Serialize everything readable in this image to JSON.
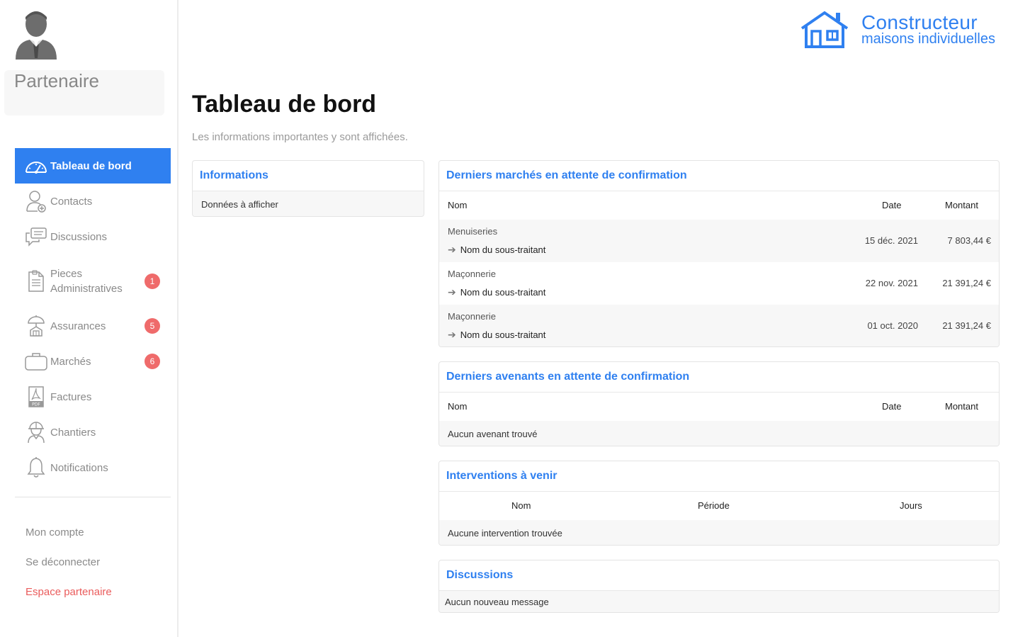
{
  "sidebar": {
    "partner_name": "Partenaire",
    "nav": [
      {
        "label": "Tableau de bord",
        "icon": "dashboard-icon",
        "active": true
      },
      {
        "label": "Contacts",
        "icon": "contacts-icon"
      },
      {
        "label": "Discussions",
        "icon": "discussions-icon"
      },
      {
        "label": "Pieces\nAdministratives",
        "icon": "documents-icon",
        "badge": "1"
      },
      {
        "label": "Assurances",
        "icon": "insurance-icon",
        "badge": "5"
      },
      {
        "label": "Marchés",
        "icon": "briefcase-icon",
        "badge": "6"
      },
      {
        "label": "Factures",
        "icon": "pdf-icon"
      },
      {
        "label": "Chantiers",
        "icon": "worker-icon"
      },
      {
        "label": "Notifications",
        "icon": "bell-icon"
      }
    ],
    "account": {
      "my_account": "Mon compte",
      "logout": "Se déconnecter",
      "partner_space": "Espace partenaire"
    }
  },
  "logo": {
    "title": "Constructeur",
    "subtitle": "maisons individuelles"
  },
  "header": {
    "title": "Tableau de bord",
    "subtitle": "Les informations importantes y sont affichées."
  },
  "informations": {
    "title": "Informations",
    "row": "Données à afficher"
  },
  "marches": {
    "title": "Derniers marchés en attente de confirmation",
    "columns": {
      "name": "Nom",
      "date": "Date",
      "amount": "Montant"
    },
    "rows": [
      {
        "name": "Menuiseries",
        "sub": "Nom du sous-traitant",
        "date": "15 déc. 2021",
        "amount": "7 803,44 €"
      },
      {
        "name": "Maçonnerie",
        "sub": "Nom du sous-traitant",
        "date": "22 nov. 2021",
        "amount": "21 391,24 €"
      },
      {
        "name": "Maçonnerie",
        "sub": "Nom du sous-traitant",
        "date": "01 oct. 2020",
        "amount": "21 391,24 €"
      }
    ]
  },
  "avenants": {
    "title": "Derniers avenants en attente de confirmation",
    "columns": {
      "name": "Nom",
      "date": "Date",
      "amount": "Montant"
    },
    "empty": "Aucun avenant trouvé"
  },
  "interventions": {
    "title": "Interventions à venir",
    "columns": {
      "name": "Nom",
      "period": "Période",
      "days": "Jours"
    },
    "empty": "Aucune intervention trouvée"
  },
  "discussions": {
    "title": "Discussions",
    "empty": "Aucun nouveau message"
  },
  "colors": {
    "accent": "#2f80f0",
    "badge": "#ef6b6b",
    "partner_link": "#ea5c5c"
  }
}
